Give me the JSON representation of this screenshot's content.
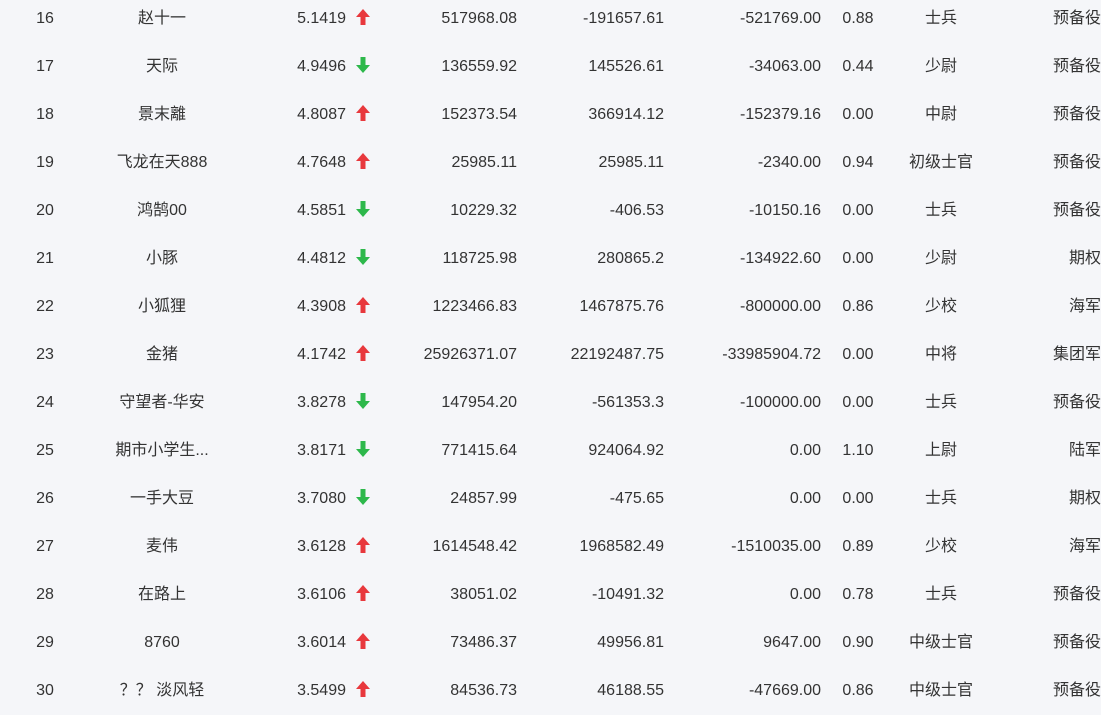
{
  "colors": {
    "up": "#e8383d",
    "down": "#2db84b",
    "text": "#333333",
    "background": "#f5f6f9"
  },
  "rows": [
    {
      "rank": "16",
      "name": "赵十一",
      "score": "5.1419",
      "trend": "up",
      "v1": "517968.08",
      "v2": "-191657.61",
      "v3": "-521769.00",
      "ratio": "0.88",
      "rank_title": "士兵",
      "group": "预备役"
    },
    {
      "rank": "17",
      "name": "天际",
      "score": "4.9496",
      "trend": "down",
      "v1": "136559.92",
      "v2": "145526.61",
      "v3": "-34063.00",
      "ratio": "0.44",
      "rank_title": "少尉",
      "group": "预备役"
    },
    {
      "rank": "18",
      "name": "景末離",
      "score": "4.8087",
      "trend": "up",
      "v1": "152373.54",
      "v2": "366914.12",
      "v3": "-152379.16",
      "ratio": "0.00",
      "rank_title": "中尉",
      "group": "预备役"
    },
    {
      "rank": "19",
      "name": "飞龙在天888",
      "score": "4.7648",
      "trend": "up",
      "v1": "25985.11",
      "v2": "25985.11",
      "v3": "-2340.00",
      "ratio": "0.94",
      "rank_title": "初级士官",
      "group": "预备役"
    },
    {
      "rank": "20",
      "name": "鸿鹄00",
      "score": "4.5851",
      "trend": "down",
      "v1": "10229.32",
      "v2": "-406.53",
      "v3": "-10150.16",
      "ratio": "0.00",
      "rank_title": "士兵",
      "group": "预备役"
    },
    {
      "rank": "21",
      "name": "小豚",
      "score": "4.4812",
      "trend": "down",
      "v1": "118725.98",
      "v2": "280865.2",
      "v3": "-134922.60",
      "ratio": "0.00",
      "rank_title": "少尉",
      "group": "期权"
    },
    {
      "rank": "22",
      "name": "小狐狸",
      "score": "4.3908",
      "trend": "up",
      "v1": "1223466.83",
      "v2": "1467875.76",
      "v3": "-800000.00",
      "ratio": "0.86",
      "rank_title": "少校",
      "group": "海军"
    },
    {
      "rank": "23",
      "name": "金猪",
      "score": "4.1742",
      "trend": "up",
      "v1": "25926371.07",
      "v2": "22192487.75",
      "v3": "-33985904.72",
      "ratio": "0.00",
      "rank_title": "中将",
      "group": "集团军"
    },
    {
      "rank": "24",
      "name": "守望者-华安",
      "score": "3.8278",
      "trend": "down",
      "v1": "147954.20",
      "v2": "-561353.3",
      "v3": "-100000.00",
      "ratio": "0.00",
      "rank_title": "士兵",
      "group": "预备役"
    },
    {
      "rank": "25",
      "name": "期市小学生...",
      "score": "3.8171",
      "trend": "down",
      "v1": "771415.64",
      "v2": "924064.92",
      "v3": "0.00",
      "ratio": "1.10",
      "rank_title": "上尉",
      "group": "陆军"
    },
    {
      "rank": "26",
      "name": "一手大豆",
      "score": "3.7080",
      "trend": "down",
      "v1": "24857.99",
      "v2": "-475.65",
      "v3": "0.00",
      "ratio": "0.00",
      "rank_title": "士兵",
      "group": "期权"
    },
    {
      "rank": "27",
      "name": "麦伟",
      "score": "3.6128",
      "trend": "up",
      "v1": "1614548.42",
      "v2": "1968582.49",
      "v3": "-1510035.00",
      "ratio": "0.89",
      "rank_title": "少校",
      "group": "海军"
    },
    {
      "rank": "28",
      "name": "在路上",
      "score": "3.6106",
      "trend": "up",
      "v1": "38051.02",
      "v2": "-10491.32",
      "v3": "0.00",
      "ratio": "0.78",
      "rank_title": "士兵",
      "group": "预备役"
    },
    {
      "rank": "29",
      "name": "8760",
      "score": "3.6014",
      "trend": "up",
      "v1": "73486.37",
      "v2": "49956.81",
      "v3": "9647.00",
      "ratio": "0.90",
      "rank_title": "中级士官",
      "group": "预备役"
    },
    {
      "rank": "30",
      "name": "？？ 淡风轻",
      "score": "3.5499",
      "trend": "up",
      "v1": "84536.73",
      "v2": "46188.55",
      "v3": "-47669.00",
      "ratio": "0.86",
      "rank_title": "中级士官",
      "group": "预备役"
    }
  ]
}
